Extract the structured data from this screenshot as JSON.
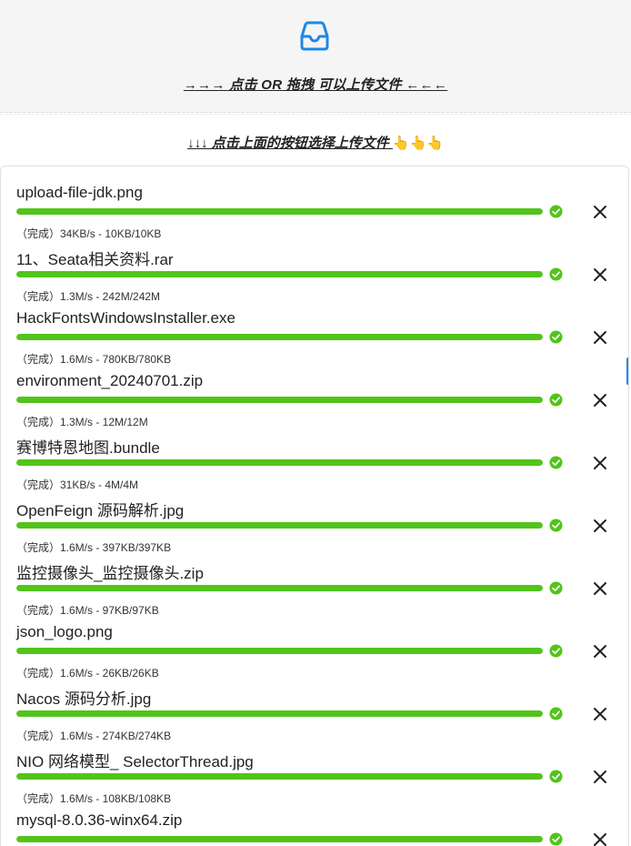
{
  "upload": {
    "icon": "inbox-icon",
    "drop_text": "→→→ 点击 OR 拖拽 可以上传文件 ←←←",
    "hint_text": "↓↓↓ 点击上面的按钮选择上传文件 ",
    "hint_emoji": "👆👆👆"
  },
  "colors": {
    "accent": "#1e88e5",
    "progress": "#52c41a",
    "dropzone_bg": "#f5f5f5"
  },
  "files": [
    {
      "name": "upload-file-jdk.png",
      "status": "（完成）34KB/s - 10KB/10KB",
      "progress": 100
    },
    {
      "name": "11、Seata相关资料.rar",
      "status": "（完成）1.3M/s - 242M/242M",
      "progress": 100
    },
    {
      "name": "HackFontsWindowsInstaller.exe",
      "status": "（完成）1.6M/s - 780KB/780KB",
      "progress": 100
    },
    {
      "name": "environment_20240701.zip",
      "status": "（完成）1.3M/s - 12M/12M",
      "progress": 100
    },
    {
      "name": "赛博特恩地图.bundle",
      "status": "（完成）31KB/s - 4M/4M",
      "progress": 100
    },
    {
      "name": "OpenFeign 源码解析.jpg",
      "status": "（完成）1.6M/s - 397KB/397KB",
      "progress": 100
    },
    {
      "name": "监控摄像头_监控摄像头.zip",
      "status": "（完成）1.6M/s - 97KB/97KB",
      "progress": 100
    },
    {
      "name": "json_logo.png",
      "status": "（完成）1.6M/s - 26KB/26KB",
      "progress": 100
    },
    {
      "name": "Nacos 源码分析.jpg",
      "status": "（完成）1.6M/s - 274KB/274KB",
      "progress": 100
    },
    {
      "name": "NIO 网络模型_ SelectorThread.jpg",
      "status": "（完成）1.6M/s - 108KB/108KB",
      "progress": 100
    },
    {
      "name": "mysql-8.0.36-winx64.zip",
      "status": "",
      "progress": 100
    }
  ]
}
